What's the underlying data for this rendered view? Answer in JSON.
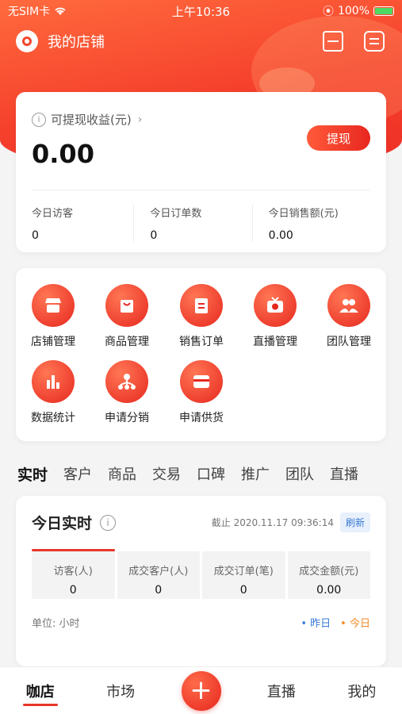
{
  "status": {
    "carrier": "无SIM卡",
    "time": "上午10:36",
    "battery": "100%"
  },
  "header": {
    "title": "我的店铺",
    "icons": [
      "scan-icon",
      "message-icon"
    ]
  },
  "earnings": {
    "label": "可提现收益(元)",
    "value": "0.00",
    "withdraw_label": "提现",
    "stats": [
      {
        "label": "今日访客",
        "value": "0"
      },
      {
        "label": "今日订单数",
        "value": "0"
      },
      {
        "label": "今日销售额(元)",
        "value": "0.00"
      }
    ]
  },
  "menu": [
    {
      "label": "店铺管理",
      "icon": "shop-icon"
    },
    {
      "label": "商品管理",
      "icon": "bag-icon"
    },
    {
      "label": "销售订单",
      "icon": "clipboard-icon"
    },
    {
      "label": "直播管理",
      "icon": "tv-icon"
    },
    {
      "label": "团队管理",
      "icon": "team-icon"
    },
    {
      "label": "数据统计",
      "icon": "bar-chart-icon"
    },
    {
      "label": "申请分销",
      "icon": "network-icon"
    },
    {
      "label": "申请供货",
      "icon": "card-icon"
    }
  ],
  "tabs": [
    "实时",
    "客户",
    "商品",
    "交易",
    "口碑",
    "推广",
    "团队",
    "直播"
  ],
  "realtime": {
    "title": "今日实时",
    "timestamp": "截止 2020.11.17 09:36:14",
    "refresh_label": "刷新",
    "metrics": [
      {
        "label": "访客(人)",
        "value": "0"
      },
      {
        "label": "成交客户(人)",
        "value": "0"
      },
      {
        "label": "成交订单(笔)",
        "value": "0"
      },
      {
        "label": "成交金额(元)",
        "value": "0.00"
      }
    ],
    "unit": "单位: 小时",
    "legend": [
      {
        "label": "昨日",
        "color": "#3a7bd5"
      },
      {
        "label": "今日",
        "color": "#f08a24"
      }
    ]
  },
  "bottom_nav": [
    "咖店",
    "市场",
    "直播",
    "我的"
  ]
}
